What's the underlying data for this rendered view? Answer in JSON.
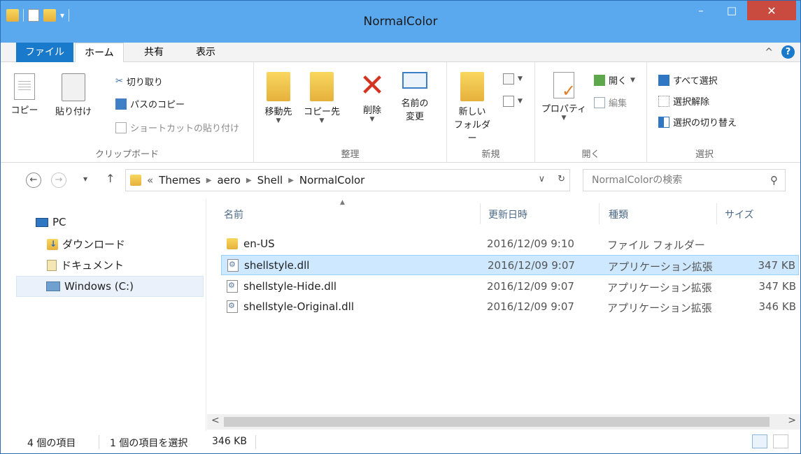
{
  "window": {
    "title": "NormalColor",
    "minimize": "–",
    "maximize": "□",
    "close": "✕"
  },
  "ribbon_tabs": {
    "file": "ファイル",
    "home": "ホーム",
    "share": "共有",
    "view": "表示",
    "collapse": "^",
    "help": "?"
  },
  "clipboard": {
    "copy": "コピー",
    "paste": "貼り付け",
    "cut": "切り取り",
    "copy_path": "パスのコピー",
    "paste_shortcut": "ショートカットの貼り付け",
    "label": "クリップボード"
  },
  "organize": {
    "move_to": "移動先",
    "copy_to": "コピー先",
    "delete": "削除",
    "rename_line1": "名前の",
    "rename_line2": "変更",
    "label": "整理"
  },
  "new_group": {
    "new_folder_line1": "新しい",
    "new_folder_line2": "フォルダー",
    "label": "新規"
  },
  "open_group": {
    "properties": "プロパティ",
    "open": "開く",
    "edit": "編集",
    "label": "開く"
  },
  "select_group": {
    "select_all": "すべて選択",
    "select_none": "選択解除",
    "invert": "選択の切り替え",
    "label": "選択"
  },
  "address": {
    "prefix": "«",
    "crumbs": [
      "Themes",
      "aero",
      "Shell",
      "NormalColor"
    ],
    "dropdown": "∨",
    "refresh": "↻",
    "search_placeholder": "NormalColorの検索",
    "back": "←",
    "forward": "→",
    "recent": "▾",
    "up": "↑"
  },
  "nav_tree": [
    {
      "label": "PC"
    },
    {
      "label": "ダウンロード"
    },
    {
      "label": "ドキュメント"
    },
    {
      "label": "Windows (C:)"
    }
  ],
  "columns": {
    "name": "名前",
    "date": "更新日時",
    "type": "種類",
    "size": "サイズ"
  },
  "files": [
    {
      "name": "en-US",
      "date": "2016/12/09 9:10",
      "type": "ファイル フォルダー",
      "size": ""
    },
    {
      "name": "shellstyle.dll",
      "date": "2016/12/09 9:07",
      "type": "アプリケーション拡張",
      "size": "347 KB"
    },
    {
      "name": "shellstyle-Hide.dll",
      "date": "2016/12/09 9:07",
      "type": "アプリケーション拡張",
      "size": "347 KB"
    },
    {
      "name": "shellstyle-Original.dll",
      "date": "2016/12/09 9:07",
      "type": "アプリケーション拡張",
      "size": "346 KB"
    }
  ],
  "status": {
    "item_count": "4 個の項目",
    "selected": "1 個の項目を選択",
    "selected_size": "346 KB"
  },
  "scroll": {
    "left": "<",
    "right": ">"
  }
}
